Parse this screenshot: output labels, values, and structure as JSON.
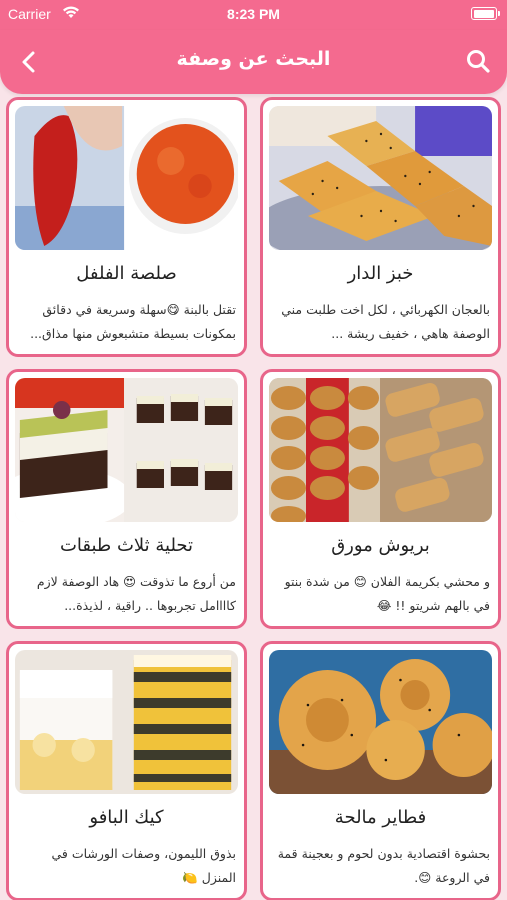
{
  "status_bar": {
    "carrier": "Carrier",
    "time": "8:23 PM",
    "battery_level": 1.0
  },
  "nav": {
    "title": "البحث عن وصفة",
    "back_icon": "chevron-left-icon",
    "search_icon": "search-icon"
  },
  "colors": {
    "accent": "#f46a8f",
    "card_border": "#e8658a",
    "background": "#f9e4e9"
  },
  "recipes": [
    {
      "title": "خبز الدار",
      "description": "بالعجان الكهربائي ، لكل اخت طلبت مني الوصفة هاهي ، خفيف ريشة ..."
    },
    {
      "title": "صلصة الفلفل",
      "description": "تقتل بالبنة 😋سهلة وسريعة في دقائق بمكونات بسيطة متشبعوش منها مذاق..."
    },
    {
      "title": "بريوش مورق",
      "description": "و محشي بكريمة الفلان 😊 من شدة بنتو في بالهم شريتو !! 😂"
    },
    {
      "title": "تحلية ثلاث طبقات",
      "description": "من أروع ما تذوقت 😍 هاد الوصفة لازم كاااامل تجربوها .. راقية ، لذيذة..."
    },
    {
      "title": "فطاير مالحة",
      "description": "بحشوة اقتصادية بدون لحوم و بعجينة قمة في الروعة 😊."
    },
    {
      "title": "كيك البافو",
      "description": "بذوق الليمون، وصفات الورشات في المنزل 🍋"
    }
  ]
}
